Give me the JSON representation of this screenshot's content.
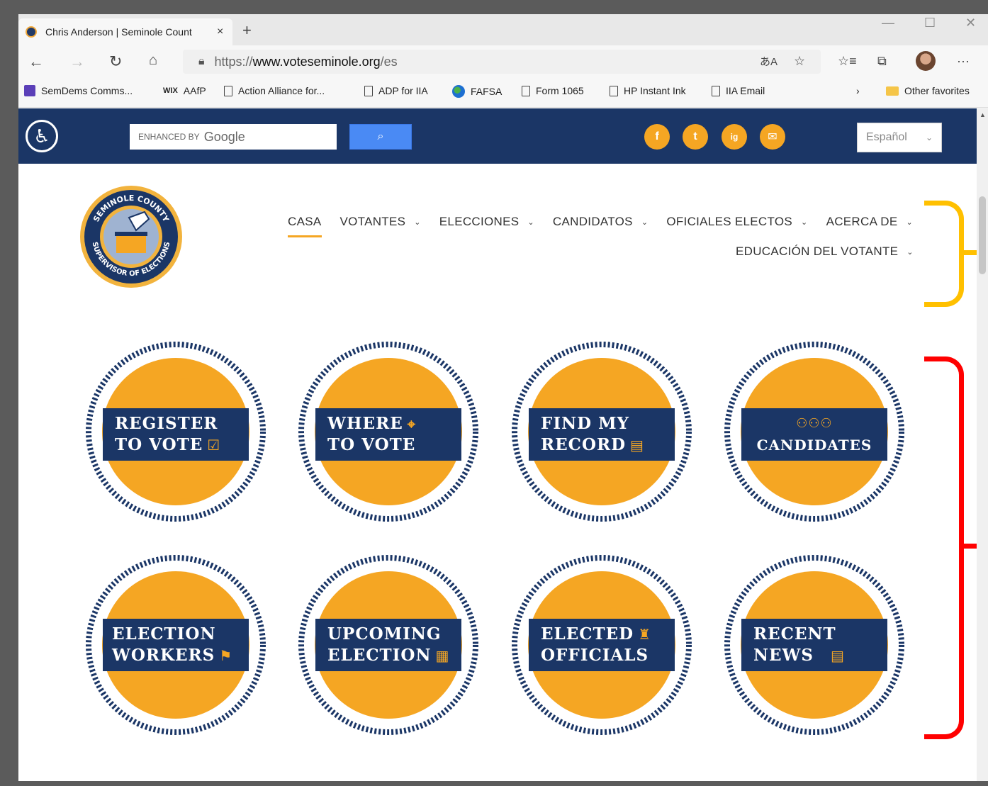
{
  "browser": {
    "tab_title": "Chris Anderson | Seminole Count",
    "tab_close": "×",
    "new_tab": "+",
    "url_prefix": "https://",
    "url_host": "www.voteseminole.org",
    "url_path": "/es",
    "icons": [
      "back-icon",
      "forward-icon",
      "refresh-icon",
      "home-icon",
      "lock-icon",
      "translate-icon",
      "star-icon",
      "favorites-icon",
      "collections-icon",
      "profile-avatar",
      "more-icon"
    ]
  },
  "favorites": [
    {
      "label": "SemDems Comms...",
      "icon": "list-icon"
    },
    {
      "label": "AAfP",
      "icon": "wix-icon"
    },
    {
      "label": "Action Alliance for...",
      "icon": "page-icon"
    },
    {
      "label": "ADP for IIA",
      "icon": "page-icon"
    },
    {
      "label": "FAFSA",
      "icon": "globe-icon"
    },
    {
      "label": "Form 1065",
      "icon": "page-icon"
    },
    {
      "label": "HP Instant Ink",
      "icon": "page-icon"
    },
    {
      "label": "IIA Email",
      "icon": "page-icon"
    },
    {
      "label": "Other favorites",
      "icon": "folder-icon"
    }
  ],
  "site": {
    "search_prefix": "ENHANCED BY",
    "search_brand": "Google",
    "social": [
      "f",
      "t",
      "ig",
      "✉"
    ],
    "language": "Español",
    "nav": [
      {
        "label": "CASA",
        "dropdown": false,
        "active": true
      },
      {
        "label": "VOTANTES",
        "dropdown": true
      },
      {
        "label": "ELECCIONES",
        "dropdown": true
      },
      {
        "label": "CANDIDATOS",
        "dropdown": true
      },
      {
        "label": "OFICIALES ELECTOS",
        "dropdown": true
      },
      {
        "label": "ACERCA DE",
        "dropdown": true
      },
      {
        "label": "EDUCACIÓN DEL VOTANTE",
        "dropdown": true
      }
    ],
    "logo": {
      "top": "SEMINOLE COUNTY",
      "bottom": "SUPERVISOR OF ELECTIONS"
    },
    "badges": [
      {
        "line1": "REGISTER",
        "line2": "TO VOTE",
        "icon": "checkbox-icon"
      },
      {
        "line1": "WHERE",
        "line2": "TO VOTE",
        "icon": "pin-icon"
      },
      {
        "line1": "FIND MY",
        "line2": "RECORD",
        "icon": "document-icon"
      },
      {
        "line1": "",
        "line2": "CANDIDATES",
        "icon": "people-icon"
      },
      {
        "line1": "ELECTION",
        "line2": "WORKERS",
        "icon": "workers-icon"
      },
      {
        "line1": "UPCOMING",
        "line2": "ELECTION",
        "icon": "calendar-icon"
      },
      {
        "line1": "ELECTED",
        "line2": "OFFICIALS",
        "icon": "official-icon"
      },
      {
        "line1": "RECENT",
        "line2": "NEWS",
        "icon": "newspaper-icon"
      }
    ]
  },
  "colors": {
    "navy": "#1b3666",
    "orange": "#f5a623",
    "bracket_yellow": "#ffc000",
    "bracket_red": "#ff0000"
  }
}
